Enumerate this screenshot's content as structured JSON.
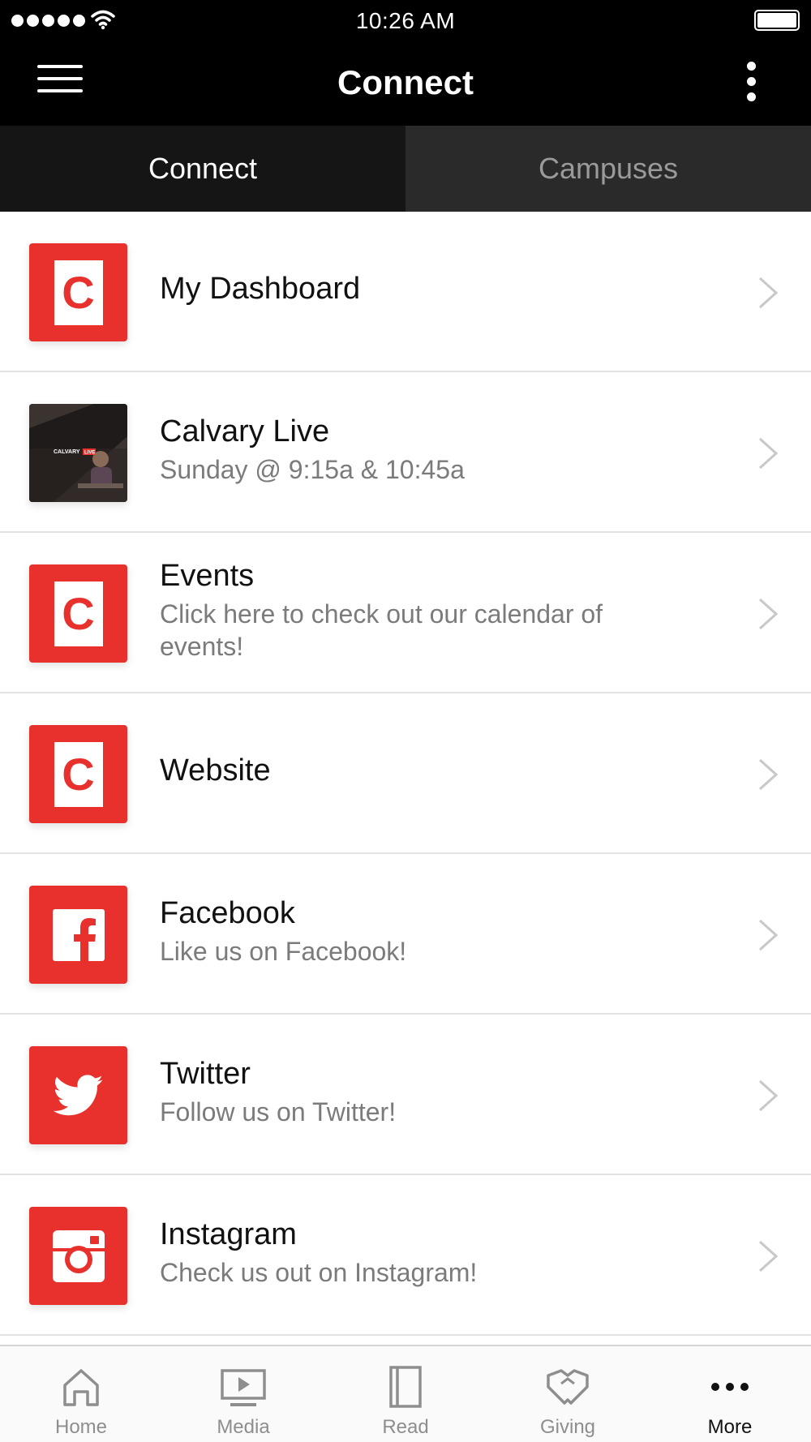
{
  "status_bar": {
    "time": "10:26 AM"
  },
  "nav": {
    "title": "Connect"
  },
  "tabs": [
    {
      "label": "Connect",
      "active": true
    },
    {
      "label": "Campuses",
      "active": false
    }
  ],
  "list": [
    {
      "title": "My Dashboard",
      "subtitle": "",
      "icon": "calvary-logo-icon"
    },
    {
      "title": "Calvary Live",
      "subtitle": "Sunday @ 9:15a & 10:45a",
      "icon": "calvary-live-thumbnail",
      "thumb_text": "CALVARY",
      "thumb_badge": "LIVE"
    },
    {
      "title": "Events",
      "subtitle": "Click here to check out our calendar of events!",
      "icon": "calvary-logo-icon"
    },
    {
      "title": "Website",
      "subtitle": "",
      "icon": "calvary-logo-icon"
    },
    {
      "title": "Facebook",
      "subtitle": "Like us on Facebook!",
      "icon": "facebook-icon"
    },
    {
      "title": "Twitter",
      "subtitle": "Follow us on Twitter!",
      "icon": "twitter-icon"
    },
    {
      "title": "Instagram",
      "subtitle": "Check us out on Instagram!",
      "icon": "instagram-icon"
    }
  ],
  "logo_letter": "C",
  "tab_bar": [
    {
      "label": "Home",
      "icon": "home-icon"
    },
    {
      "label": "Media",
      "icon": "media-icon"
    },
    {
      "label": "Read",
      "icon": "read-icon"
    },
    {
      "label": "Giving",
      "icon": "giving-icon"
    },
    {
      "label": "More",
      "icon": "more-icon",
      "selected": true
    }
  ],
  "colors": {
    "brand_red": "#e8312c",
    "nav_background": "#000000",
    "tab_active": "#151515",
    "tab_inactive": "#2a2a2a"
  }
}
